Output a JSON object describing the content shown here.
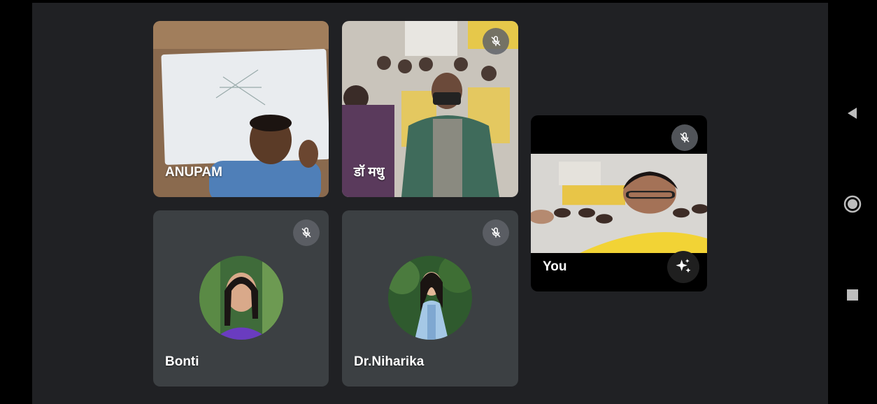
{
  "participants": [
    {
      "name": "ANUPAM",
      "muted": false
    },
    {
      "name": "डॉ मधु",
      "muted": true
    },
    {
      "name": "Bonti",
      "muted": true
    },
    {
      "name": "Dr.Niharika",
      "muted": true
    },
    {
      "name": "You",
      "muted": true
    }
  ],
  "colors": {
    "stage_bg": "#202124",
    "tile_bg": "#3c4043",
    "mic_badge": "#5f6368",
    "text": "#ffffff"
  },
  "icons": {
    "mic_off": "mic-off-icon",
    "effects": "sparkle-icon",
    "nav_back": "triangle-back-icon",
    "nav_home": "circle-home-icon",
    "nav_recents": "square-recents-icon"
  }
}
